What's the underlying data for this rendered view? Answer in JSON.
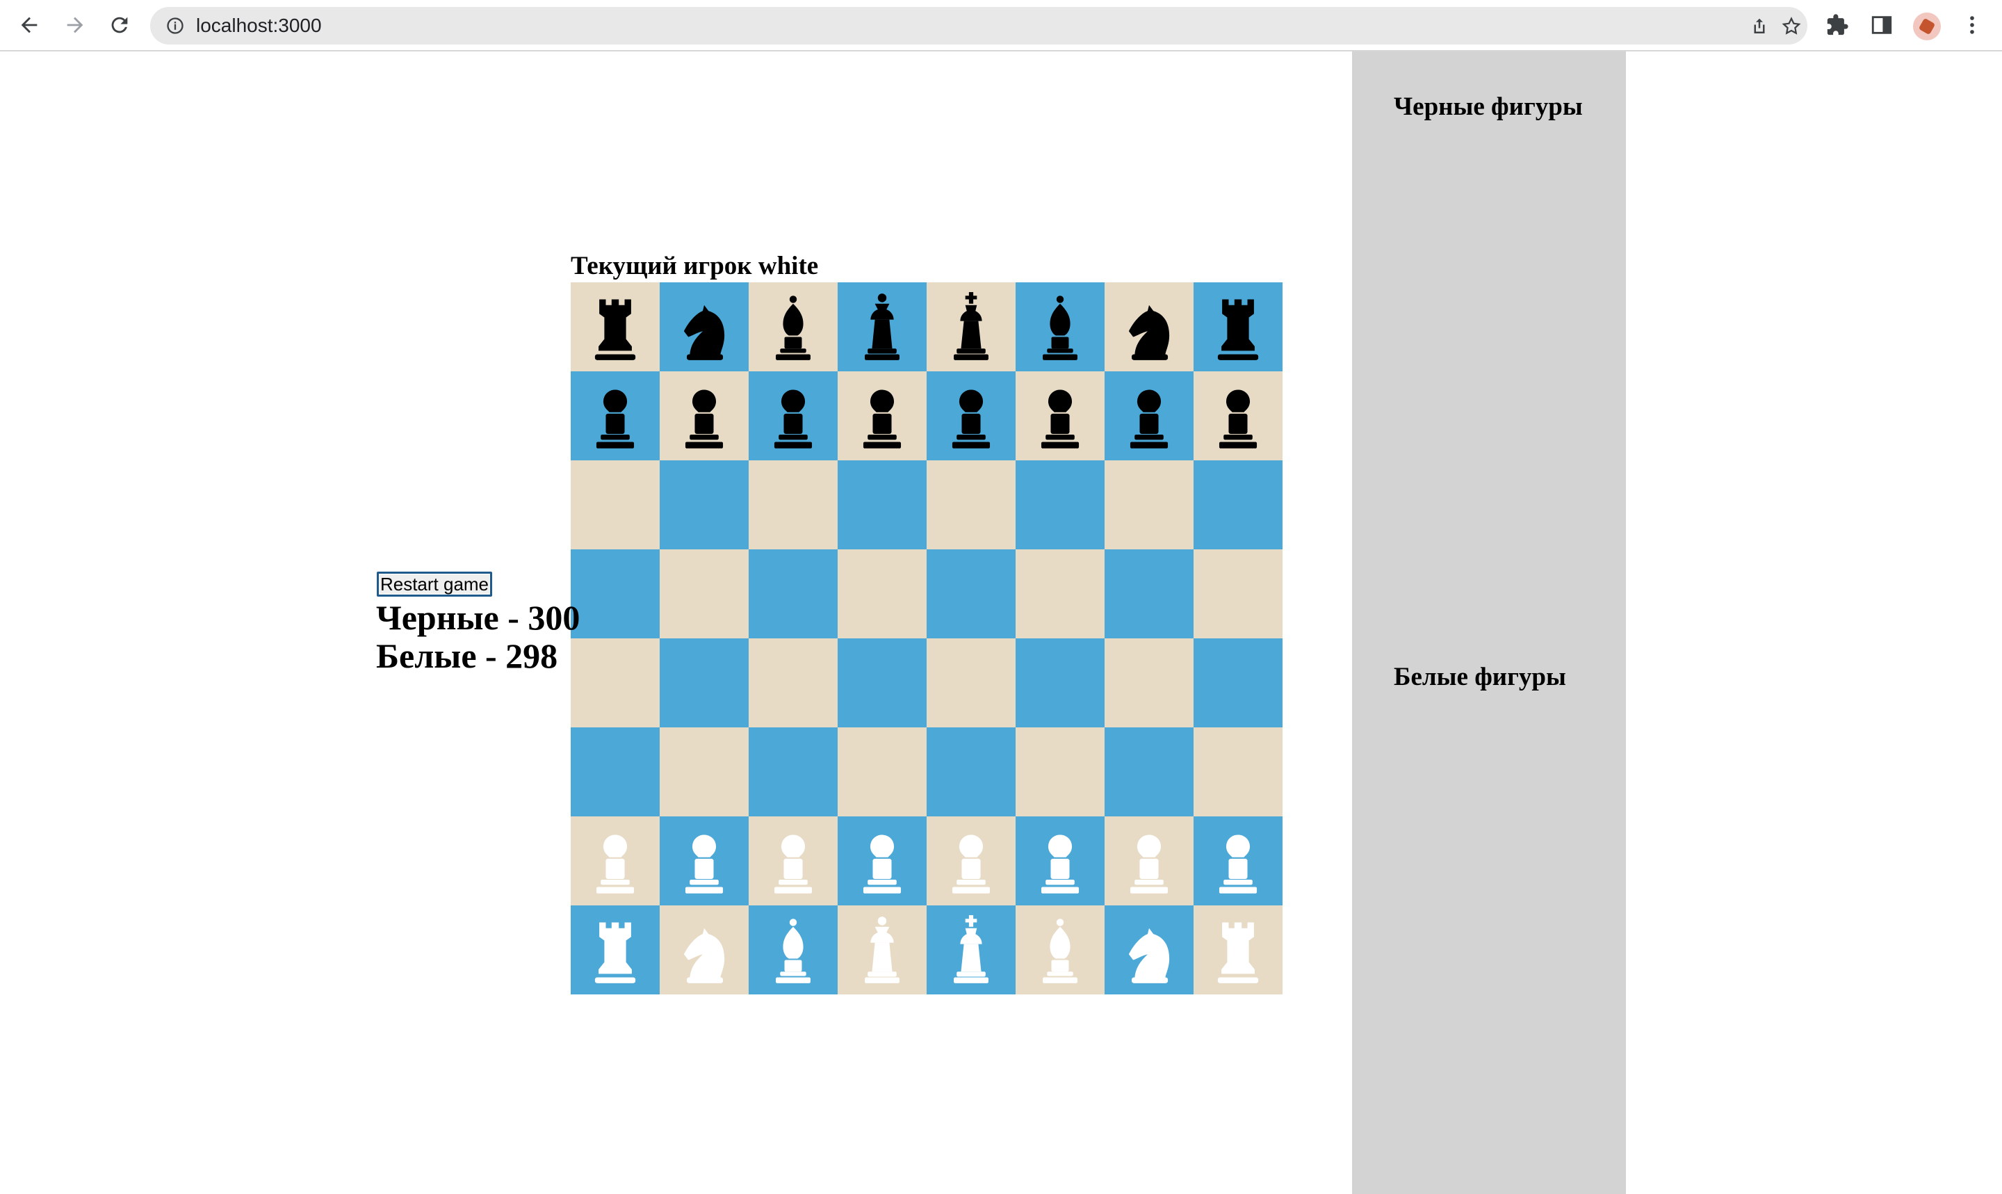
{
  "browser": {
    "url": "localhost:3000"
  },
  "game": {
    "current_player_label": "Текущий игрок white",
    "restart_label": "Restart game",
    "score_black": "Черные - 300",
    "score_white": "Белые - 298",
    "sidebar_black_title": "Черные фигуры",
    "sidebar_white_title": "Белые фигуры",
    "colors": {
      "light_square": "#e8dbc6",
      "dark_square": "#4ba8d7",
      "sidebar": "#d3d3d3"
    },
    "board": [
      [
        "br",
        "bn",
        "bb",
        "bq",
        "bk",
        "bb",
        "bn",
        "br"
      ],
      [
        "bp",
        "bp",
        "bp",
        "bp",
        "bp",
        "bp",
        "bp",
        "bp"
      ],
      [
        "",
        "",
        "",
        "",
        "",
        "",
        "",
        ""
      ],
      [
        "",
        "",
        "",
        "",
        "",
        "",
        "",
        ""
      ],
      [
        "",
        "",
        "",
        "",
        "",
        "",
        "",
        ""
      ],
      [
        "",
        "",
        "",
        "",
        "",
        "",
        "",
        ""
      ],
      [
        "wp",
        "wp",
        "wp",
        "wp",
        "wp",
        "wp",
        "wp",
        "wp"
      ],
      [
        "wr",
        "wn",
        "wb",
        "wq",
        "wk",
        "wb",
        "wn",
        "wr"
      ]
    ],
    "board_first_square": "light"
  }
}
